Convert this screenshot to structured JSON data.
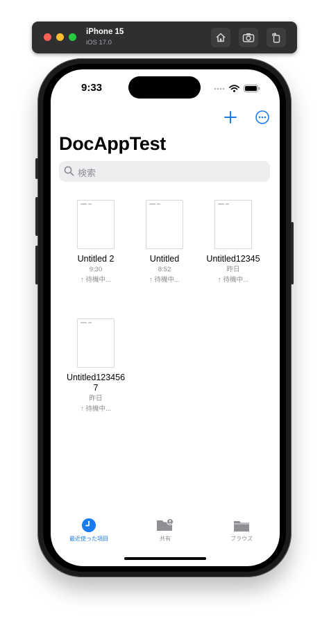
{
  "simulator": {
    "device_name": "iPhone 15",
    "os_version": "iOS 17.0",
    "icons": [
      "home-icon",
      "screenshot-icon",
      "rotate-icon"
    ]
  },
  "status_bar": {
    "time": "9:33"
  },
  "nav": {
    "title": "DocAppTest",
    "add_icon": "plus-icon",
    "more_icon": "ellipsis-circle-icon"
  },
  "search": {
    "placeholder": "検索"
  },
  "documents": [
    {
      "name": "Untitled 2",
      "date": "9:30",
      "status": "↑ 待機中..."
    },
    {
      "name": "Untitled",
      "date": "8:52",
      "status": "↑ 待機中..."
    },
    {
      "name": "Untitled12345",
      "date": "昨日",
      "status": "↑ 待機中..."
    },
    {
      "name": "Untitled1234567",
      "date": "昨日",
      "status": "↑ 待機中..."
    }
  ],
  "tabbar": {
    "tabs": [
      {
        "label": "最近使った項目",
        "icon": "clock-icon",
        "active": true
      },
      {
        "label": "共有",
        "icon": "shared-folder-icon",
        "active": false
      },
      {
        "label": "ブラウズ",
        "icon": "folder-icon",
        "active": false
      }
    ]
  },
  "colors": {
    "accent": "#1a7cf5",
    "secondary_text": "#8e8e93",
    "search_bg": "#eeeef0"
  }
}
